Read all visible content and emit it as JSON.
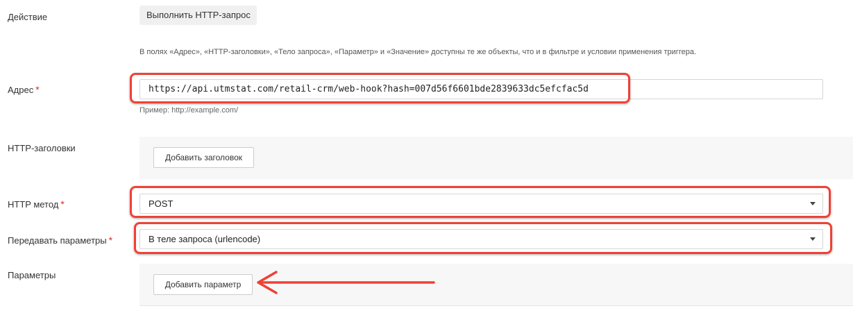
{
  "action": {
    "label": "Действие",
    "button": "Выполнить HTTP-запрос"
  },
  "hint": "В полях «Адрес», «HTTP-заголовки», «Тело запроса», «Параметр» и «Значение» доступны те же объекты, что и в фильтре и условии применения триггера.",
  "address": {
    "label": "Адрес",
    "required_mark": "*",
    "value": "https://api.utmstat.com/retail-crm/web-hook?hash=007d56f6601bde2839633dc5efcfac5d",
    "example": "Пример: http://example.com/"
  },
  "headers": {
    "label": "HTTP-заголовки",
    "add_button": "Добавить заголовок"
  },
  "method": {
    "label": "HTTP метод",
    "required_mark": "*",
    "value": "POST"
  },
  "pass_params": {
    "label": "Передавать параметры",
    "required_mark": "*",
    "value": "В теле запроса (urlencode)"
  },
  "params": {
    "label": "Параметры",
    "add_button": "Добавить параметр"
  },
  "colors": {
    "annotation": "#ef4135",
    "required": "#e5281e",
    "panel_bg": "#f7f7f7"
  }
}
